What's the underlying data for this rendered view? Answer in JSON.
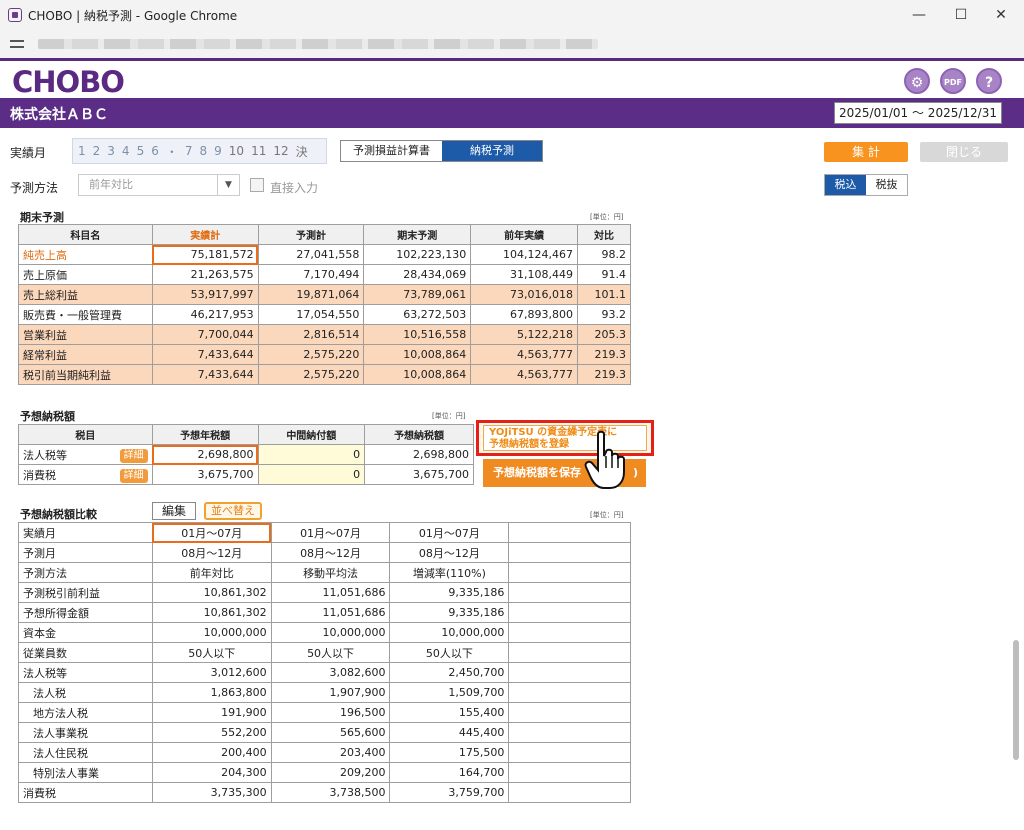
{
  "window": {
    "title": "CHOBO | 納税予測 - Google Chrome",
    "minimize": "—",
    "maximize": "☐",
    "close": "✕"
  },
  "app": {
    "logo": "CHOBO",
    "company": "株式会社ＡＢＣ",
    "period": "2025/01/01 ～ 2025/12/31",
    "icons": [
      "gear-icon",
      "pdf-icon",
      "help-icon"
    ]
  },
  "controls": {
    "actual_month_label": "実績月",
    "months": [
      "1",
      "2",
      "3",
      "4",
      "5",
      "6",
      "・",
      "7",
      "8",
      "9",
      "10",
      "11",
      "12",
      "決"
    ],
    "tabs": [
      "予測損益計算書",
      "納税予測"
    ],
    "active_tab": "納税予測",
    "aggregate_button": "集 計",
    "close_button": "閉じる",
    "method_label": "予測方法",
    "method_value": "前年対比",
    "direct_input_label": "直接入力",
    "tax_options": [
      "税込",
      "税抜"
    ],
    "tax_selected": "税込"
  },
  "forecast": {
    "title": "期末予測",
    "unit": "[単位：円]",
    "headers": [
      "科目名",
      "実績計",
      "予測計",
      "期末予測",
      "前年実績",
      "対比"
    ],
    "rows": [
      {
        "name": "純売上高",
        "actual": "75,181,572",
        "forecast": "27,041,558",
        "year_end": "102,223,130",
        "prev": "104,124,467",
        "ratio": "98.2"
      },
      {
        "name": "売上原価",
        "actual": "21,263,575",
        "forecast": "7,170,494",
        "year_end": "28,434,069",
        "prev": "31,108,449",
        "ratio": "91.4"
      },
      {
        "name": "売上総利益",
        "actual": "53,917,997",
        "forecast": "19,871,064",
        "year_end": "73,789,061",
        "prev": "73,016,018",
        "ratio": "101.1"
      },
      {
        "name": "販売費・一般管理費",
        "actual": "46,217,953",
        "forecast": "17,054,550",
        "year_end": "63,272,503",
        "prev": "67,893,800",
        "ratio": "93.2"
      },
      {
        "name": "営業利益",
        "actual": "7,700,044",
        "forecast": "2,816,514",
        "year_end": "10,516,558",
        "prev": "5,122,218",
        "ratio": "205.3"
      },
      {
        "name": "経常利益",
        "actual": "7,433,644",
        "forecast": "2,575,220",
        "year_end": "10,008,864",
        "prev": "4,563,777",
        "ratio": "219.3"
      },
      {
        "name": "税引前当期純利益",
        "actual": "7,433,644",
        "forecast": "2,575,220",
        "year_end": "10,008,864",
        "prev": "4,563,777",
        "ratio": "219.3"
      }
    ]
  },
  "tax": {
    "title": "予想納税額",
    "unit": "[単位：円]",
    "headers": [
      "税目",
      "予想年税額",
      "中間納付額",
      "予想納税額"
    ],
    "detail_label": "詳細",
    "rows": [
      {
        "name": "法人税等",
        "annual": "2,698,800",
        "interim": "0",
        "due": "2,698,800"
      },
      {
        "name": "消費税",
        "annual": "3,675,700",
        "interim": "0",
        "due": "3,675,700"
      }
    ],
    "yojitsu_line1": "YOJiTSU の資金繰予定表に",
    "yojitsu_line2": "予想納税額を登録",
    "save_button": "予想納税額を保存",
    "save_button_tail": ")"
  },
  "compare": {
    "title": "予想納税額比較",
    "edit_button": "編集",
    "sort_button": "並べ替え",
    "unit": "[単位：円]",
    "rows": [
      {
        "label": "実績月",
        "v": [
          "01月～07月",
          "01月～07月",
          "01月～07月"
        ],
        "type": "ctr"
      },
      {
        "label": "予測月",
        "v": [
          "08月～12月",
          "08月～12月",
          "08月～12月"
        ],
        "type": "ctr"
      },
      {
        "label": "予測方法",
        "v": [
          "前年対比",
          "移動平均法",
          "増減率(110%)"
        ],
        "type": "ctr"
      },
      {
        "label": "予測税引前利益",
        "v": [
          "10,861,302",
          "11,051,686",
          "9,335,186"
        ],
        "type": "num"
      },
      {
        "label": "予想所得金額",
        "v": [
          "10,861,302",
          "11,051,686",
          "9,335,186"
        ],
        "type": "num"
      },
      {
        "label": "資本金",
        "v": [
          "10,000,000",
          "10,000,000",
          "10,000,000"
        ],
        "type": "num"
      },
      {
        "label": "従業員数",
        "v": [
          "50人以下",
          "50人以下",
          "50人以下"
        ],
        "type": "ctr"
      },
      {
        "label": "法人税等",
        "v": [
          "3,012,600",
          "3,082,600",
          "2,450,700"
        ],
        "type": "num"
      },
      {
        "label": "法人税",
        "v": [
          "1,863,800",
          "1,907,900",
          "1,509,700"
        ],
        "type": "num",
        "indent": true
      },
      {
        "label": "地方法人税",
        "v": [
          "191,900",
          "196,500",
          "155,400"
        ],
        "type": "num",
        "indent": true
      },
      {
        "label": "法人事業税",
        "v": [
          "552,200",
          "565,600",
          "445,400"
        ],
        "type": "num",
        "indent": true
      },
      {
        "label": "法人住民税",
        "v": [
          "200,400",
          "203,400",
          "175,500"
        ],
        "type": "num",
        "indent": true
      },
      {
        "label": "特別法人事業",
        "v": [
          "204,300",
          "209,200",
          "164,700"
        ],
        "type": "num",
        "indent": true
      },
      {
        "label": "消費税",
        "v": [
          "3,735,300",
          "3,738,500",
          "3,759,700"
        ],
        "type": "num"
      }
    ]
  }
}
